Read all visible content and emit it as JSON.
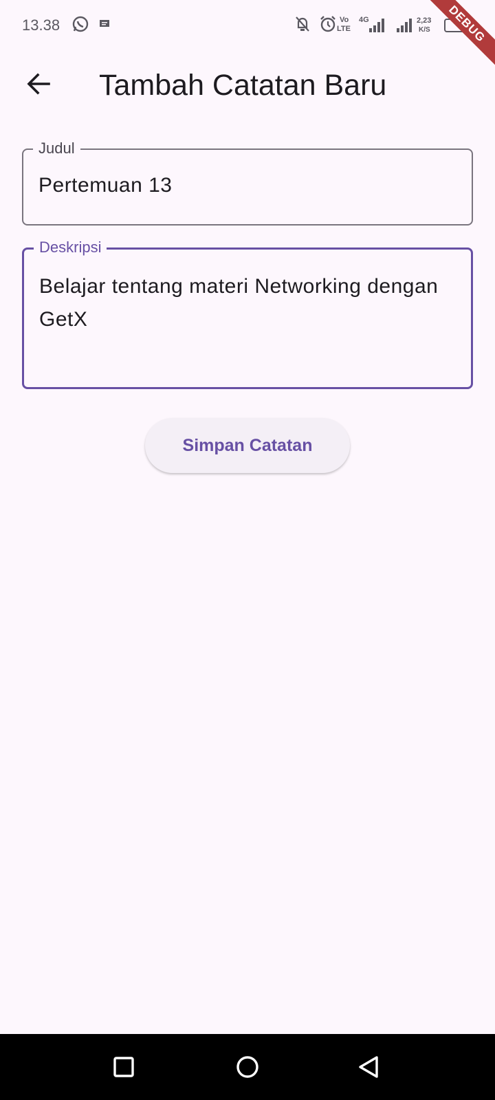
{
  "status_bar": {
    "time": "13.38",
    "volte_top": "Vo",
    "volte_bottom": "LTE",
    "network": "4G",
    "speed_value": "2,23",
    "speed_unit": "K/S",
    "icons": [
      "whatsapp-icon",
      "message-icon",
      "bell-off-icon",
      "alarm-icon",
      "signal-icon",
      "battery-icon"
    ]
  },
  "debug_banner": "DEBUG",
  "app_bar": {
    "title": "Tambah Catatan Baru",
    "back_icon": "arrow-left-icon"
  },
  "form": {
    "title_field": {
      "label": "Judul",
      "value": "Pertemuan 13"
    },
    "description_field": {
      "label": "Deskripsi",
      "value": "Belajar tentang materi Networking dengan GetX"
    },
    "save_label": "Simpan Catatan"
  },
  "colors": {
    "background": "#fdf7fd",
    "primary": "#6750a4",
    "outline": "#79747e"
  },
  "nav_bar": {
    "icons": [
      "recent-apps-icon",
      "home-icon",
      "back-icon"
    ]
  }
}
